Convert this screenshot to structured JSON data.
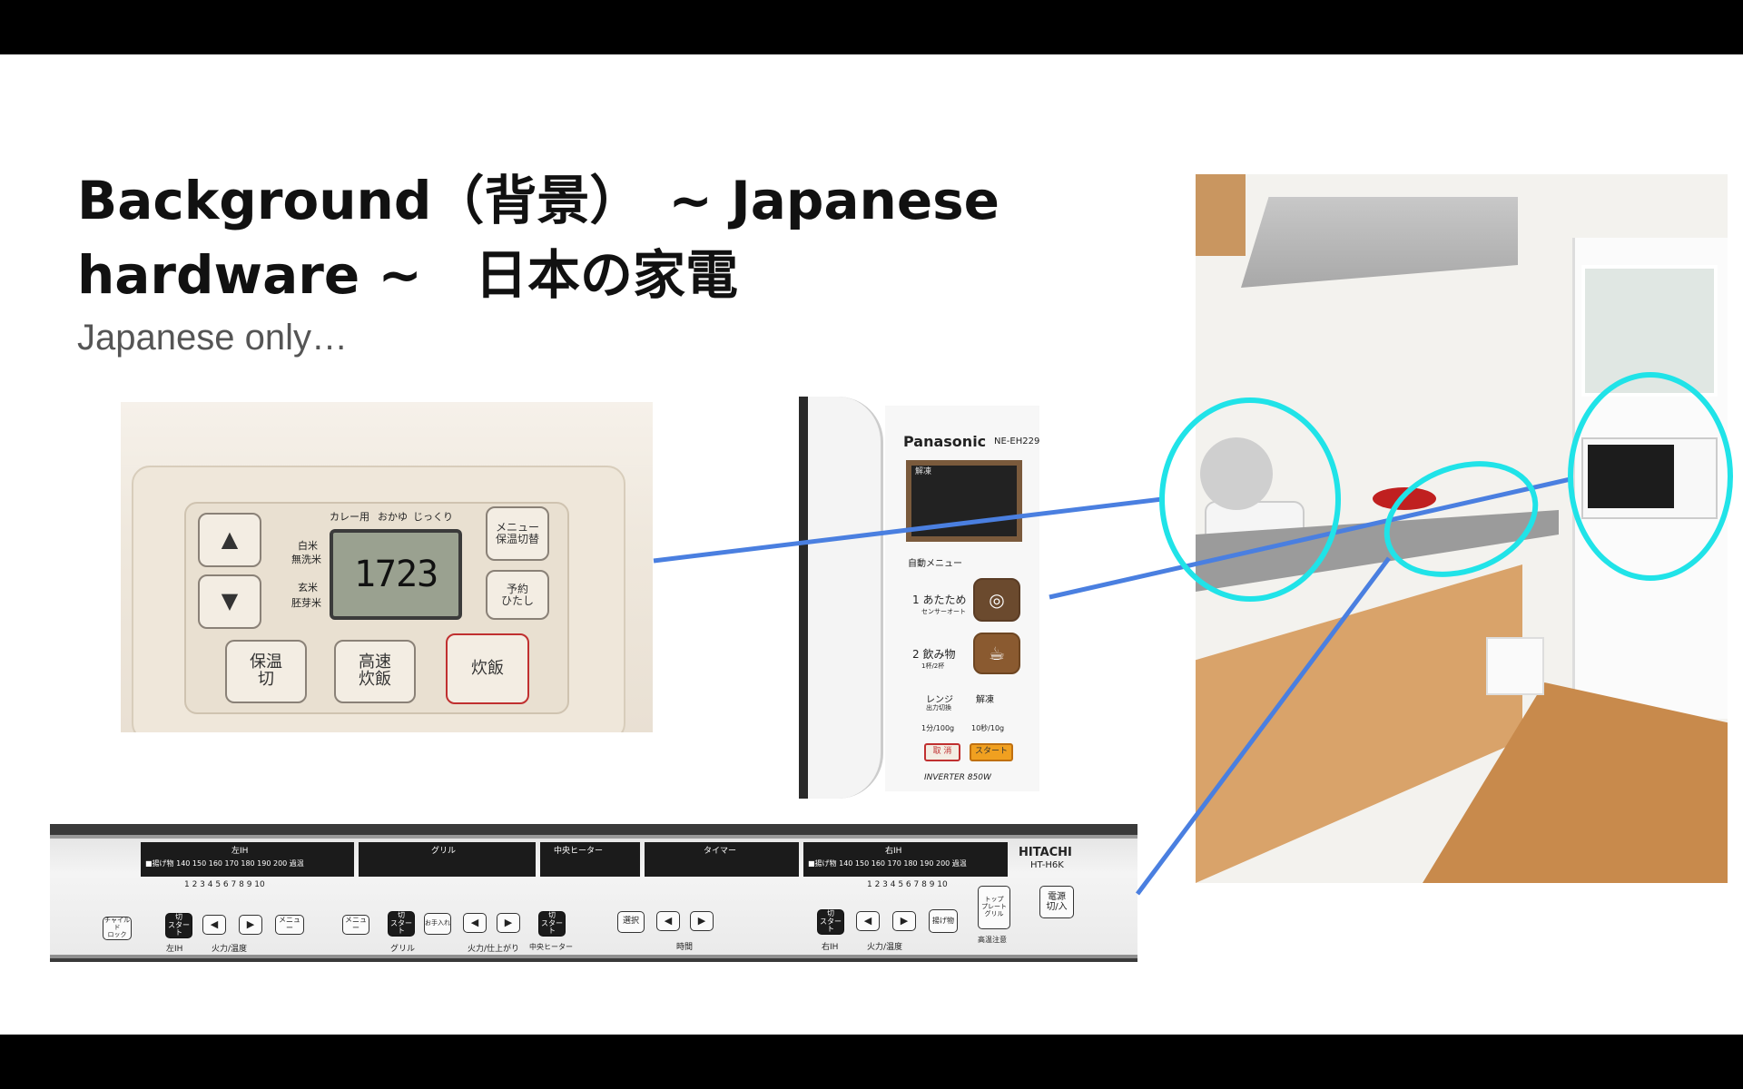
{
  "slide": {
    "title_line1": "Background（背景）　~ Japanese",
    "title_line2": "hardware ~　日本の家電",
    "subtitle": "Japanese only…"
  },
  "rice_cooker": {
    "top_labels": [
      "カレー用",
      "おかゆ",
      "じっくり"
    ],
    "side_labels": [
      "白米",
      "無洗米",
      "玄米",
      "胚芽米"
    ],
    "display": "1723",
    "menu_button": "メニュー\n保温切替",
    "timer_button": "予約\nひたし",
    "keep_warm_button": "保温\n切",
    "fast_button": "高速\n炊飯",
    "cook_button": "炊飯",
    "up_arrow": "▲",
    "down_arrow": "▼"
  },
  "microwave": {
    "brand": "Panasonic",
    "model": "NE-EH229",
    "window_label": "解凍",
    "auto_menu": "自動メニュー",
    "item1": "1 あたため",
    "item1_sub": "センサーオート",
    "item2": "2 飲み物",
    "item2_sub": "1杯/2杯",
    "range_label": "レンジ",
    "range_sub": "出力切換",
    "thaw_label": "解凍",
    "time1": "1分/100g",
    "time2": "10秒/10g",
    "cancel": "取 消",
    "start": "スタート",
    "inverter": "INVERTER 850W"
  },
  "stove": {
    "left_ih": "左IH",
    "grill": "グリル",
    "center_heater": "中央ヒーター",
    "timer": "タイマー",
    "right_ih": "右IH",
    "brand": "HITACHI",
    "model": "HT-H6K",
    "temps_left": "■揚げ物 140 150 160 170 180 190 200 過温",
    "temps_right": "■揚げ物 140 150 160 170 180 190 200 過温",
    "levels": "1 2 3 4 5 6 7 8 9 10",
    "lock": "チャイルド\nロック",
    "start_left": "切\nスタート",
    "menu": "メニュー",
    "power_temp": "火力/温度",
    "left_ih_label": "左IH",
    "grill_start": "切\nスタート",
    "grill_label": "グリル",
    "finish": "火力/仕上がり",
    "center_start": "切\nスタート",
    "center_label": "中央ヒーター",
    "select": "選択",
    "time": "時間",
    "right_start": "切\nスタート",
    "right_ih_label": "右IH",
    "fry": "揚げ物",
    "top_plate": "トップ\nプレート\nグリル",
    "high_temp": "高温注意",
    "power": "電源\n切/入",
    "left_arrow": "◀",
    "right_arrow": "▶",
    "menu2": "メニュー",
    "clean": "お手入れ"
  },
  "colors": {
    "connector": "#4a7fe0",
    "highlight": "#20e3e8"
  }
}
